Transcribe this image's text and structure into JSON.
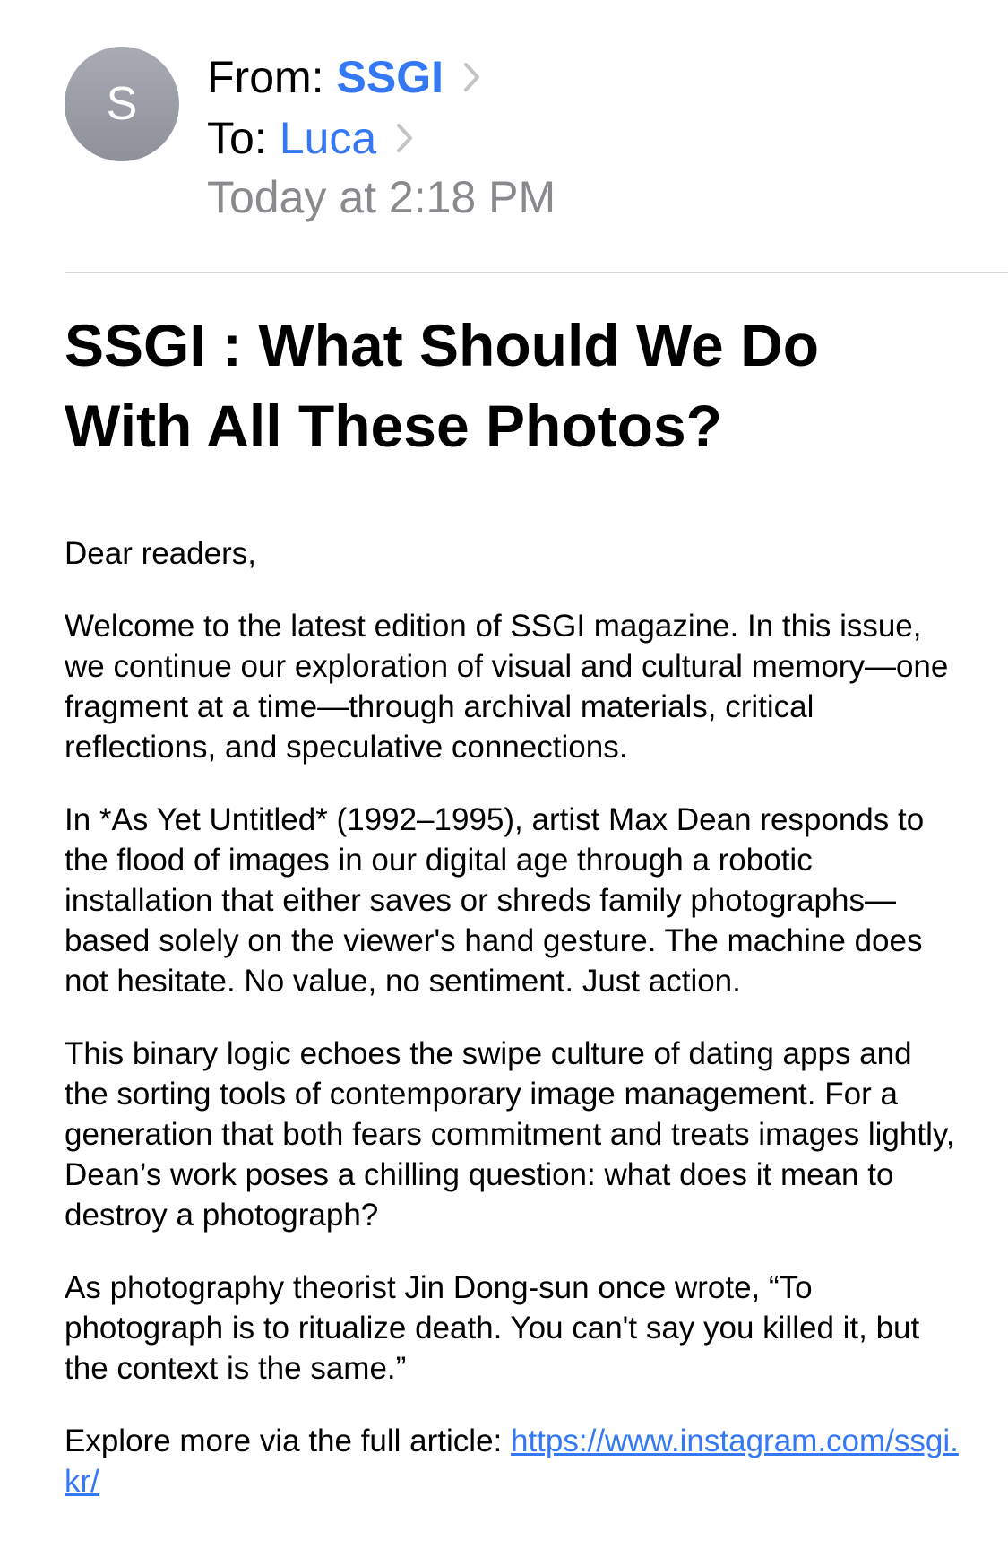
{
  "header": {
    "avatar_initial": "S",
    "from_prefix": "From:",
    "from_name": "SSGI",
    "to_prefix": "To:",
    "to_name": "Luca",
    "date": "Today at 2:18 PM",
    "chevron_icon": "chevron-right-icon"
  },
  "subject": "SSGI : What Should We Do With All These Photos?",
  "body": {
    "paragraphs": [
      "Dear readers,",
      "Welcome to the latest edition of SSGI magazine. In this issue, we continue our exploration of visual and cultural memory—one fragment at a time—through archival materials, critical reflections, and speculative connections.",
      "In *As Yet Untitled* (1992–1995), artist Max Dean responds to the flood of images in our digital age through a robotic installation that either saves or shreds family photographs—based solely on the viewer's hand gesture. The machine does not hesitate. No value, no sentiment. Just action.",
      "This binary logic echoes the swipe culture of dating apps and the sorting tools of contemporary image management. For a generation that both fears commitment and treats images lightly, Dean’s work poses a chilling question: what does it mean to destroy a photograph?",
      "As photography theorist Jin Dong-sun once wrote, “To photograph is to ritualize death. You can't say you killed it, but the context is the same.”"
    ],
    "explore_text": "Explore more via the full article: ",
    "link_text": "https://www.instagram.com/ssgi.kr/"
  },
  "colors": {
    "link": "#3478f6",
    "secondary_text": "#8a8a8e",
    "avatar": "#9a9da5",
    "divider": "#d6d6d8"
  }
}
